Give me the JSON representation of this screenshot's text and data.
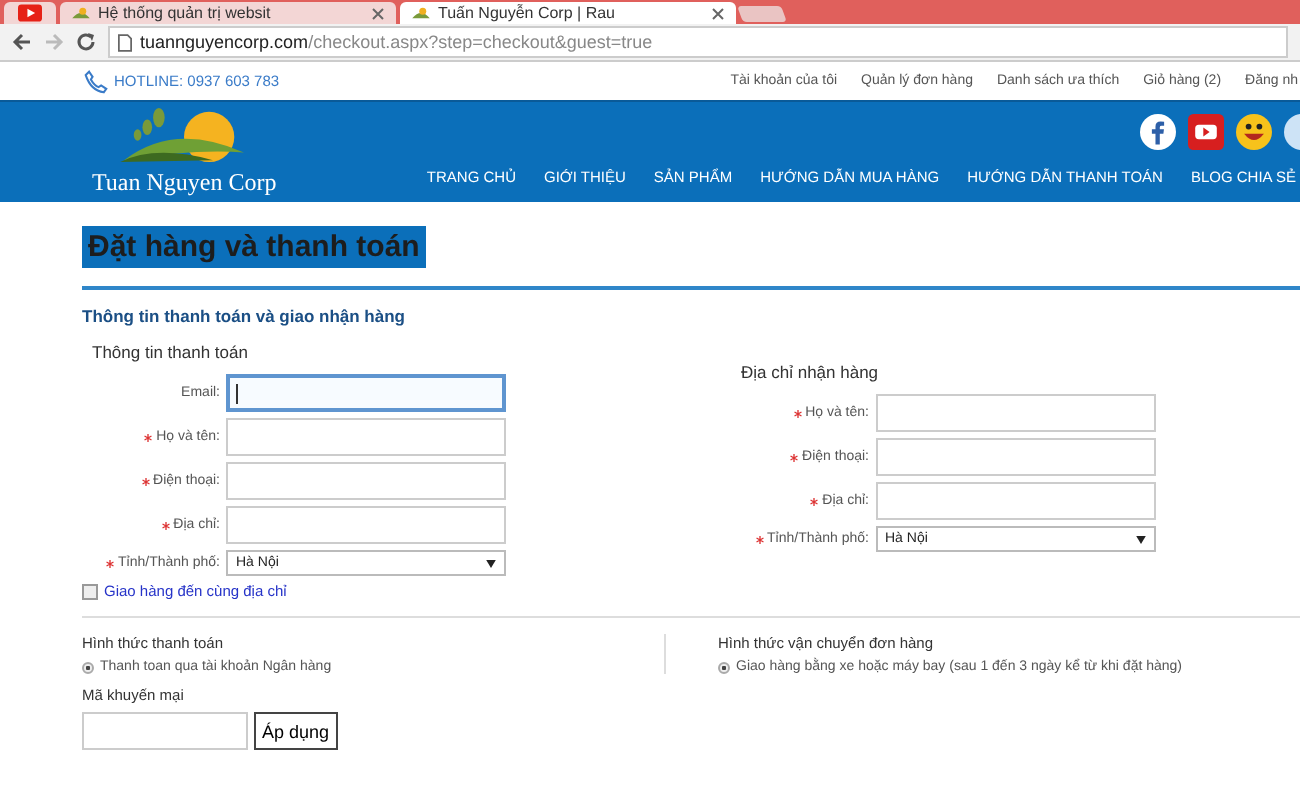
{
  "browser": {
    "tabs": [
      {
        "kind": "pinned",
        "selected": false
      },
      {
        "kind": "page",
        "label": "Hệ thống quản trị websit",
        "selected": false
      },
      {
        "kind": "page",
        "label": "Tuấn Nguyễn Corp | Rau",
        "selected": true
      }
    ],
    "url_host": "tuannguyencorp.com",
    "url_path": "/checkout.aspx?step=checkout&guest=true"
  },
  "topbar": {
    "hotline": "HOTLINE: 0937 603 783",
    "links": [
      "Tài khoản của tôi",
      "Quản lý đơn hàng",
      "Danh sách ưa thích",
      "Giỏ hàng (2)",
      "Đăng nh"
    ]
  },
  "header": {
    "logo_text": "Tuan Nguyen Corp",
    "nav": [
      "TRANG CHỦ",
      "GIỚI THIỆU",
      "SẢN PHẨM",
      "HƯỚNG DẪN MUA HÀNG",
      "HƯỚNG DẪN THANH TOÁN",
      "BLOG CHIA SẺ"
    ]
  },
  "page_title": "Đặt hàng và thanh toán",
  "section_title": "Thông tin thanh toán và giao nhận hàng",
  "billing": {
    "title": "Thông tin thanh toán",
    "fields": [
      {
        "kind": "text",
        "label": "Email:",
        "required": false,
        "focused": true
      },
      {
        "kind": "text",
        "label": "Họ và tên:",
        "required": true,
        "focused": false
      },
      {
        "kind": "text",
        "label": "Điện thoại:",
        "required": true,
        "focused": false
      },
      {
        "kind": "text",
        "label": "Địa chỉ:",
        "required": true,
        "focused": false
      },
      {
        "kind": "select",
        "label": "Tỉnh/Thành phố:",
        "required": true,
        "value": "Hà Nội"
      }
    ],
    "same_address": {
      "label": "Giao hàng đến cùng địa chỉ",
      "checked": false
    }
  },
  "shipping_address": {
    "title": "Địa chỉ nhận hàng",
    "fields": [
      {
        "kind": "text",
        "label": "Họ và tên:",
        "required": true,
        "focused": false
      },
      {
        "kind": "text",
        "label": "Điện thoại:",
        "required": true,
        "focused": false
      },
      {
        "kind": "text",
        "label": "Địa chỉ:",
        "required": true,
        "focused": false
      },
      {
        "kind": "select",
        "label": "Tỉnh/Thành phố:",
        "required": true,
        "value": "Hà Nội"
      }
    ]
  },
  "payment": {
    "title": "Hình thức thanh toán",
    "options": [
      {
        "label": "Thanh toan qua tài khoản Ngân hàng",
        "selected": true
      }
    ]
  },
  "delivery": {
    "title": "Hình thức vận chuyển đơn hàng",
    "options": [
      {
        "label": "Giao hàng bằng xe hoặc máy bay (sau 1 đến 3 ngày kể từ khi đặt hàng)",
        "selected": true
      }
    ]
  },
  "promo": {
    "title": "Mã khuyến mại",
    "button": "Áp dụng"
  }
}
